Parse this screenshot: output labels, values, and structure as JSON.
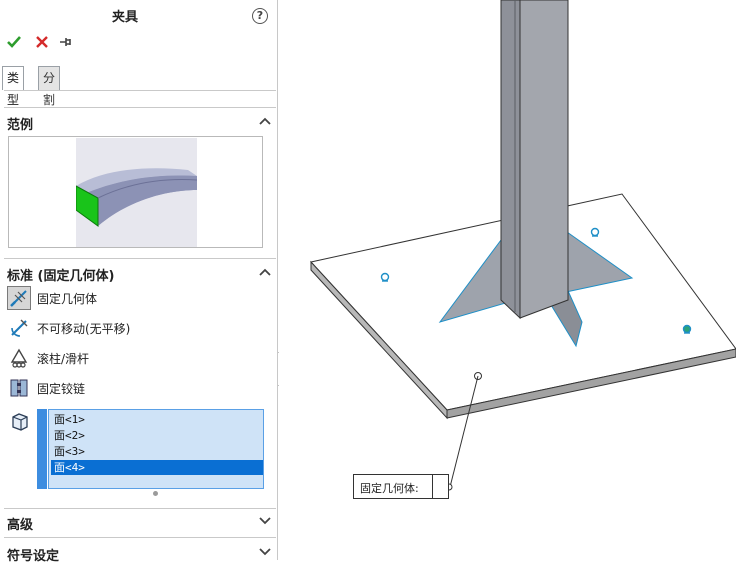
{
  "panel": {
    "title": "夹具",
    "help_label": "?",
    "actions": {
      "ok": "check-icon",
      "cancel": "close-icon",
      "pin": "pushpin-icon"
    },
    "tabs": [
      {
        "label": "类型",
        "active": true
      },
      {
        "label": "分割",
        "active": false
      }
    ]
  },
  "example_section": {
    "title": "范例"
  },
  "standard_section": {
    "title": "标准 (固定几何体)",
    "options": [
      {
        "label": "固定几何体",
        "icon": "fixed-geometry-icon",
        "selected": true
      },
      {
        "label": "不可移动(无平移)",
        "icon": "immovable-icon",
        "selected": false
      },
      {
        "label": "滚柱/滑杆",
        "icon": "roller-slider-icon",
        "selected": false
      },
      {
        "label": "固定铰链",
        "icon": "fixed-hinge-icon",
        "selected": false
      }
    ],
    "faces": [
      "面<1>",
      "面<2>",
      "面<3>",
      "面<4>"
    ],
    "selected_face_index": 3
  },
  "advanced_section": {
    "title": "高级"
  },
  "symbol_section": {
    "title": "符号设定"
  },
  "viewport": {
    "callout_label": "固定几何体:",
    "colors": {
      "accent": "#0a6fd3",
      "edge": "#1e8fc7",
      "gusset": "#9ea3ac",
      "column": "#8e9199"
    }
  }
}
